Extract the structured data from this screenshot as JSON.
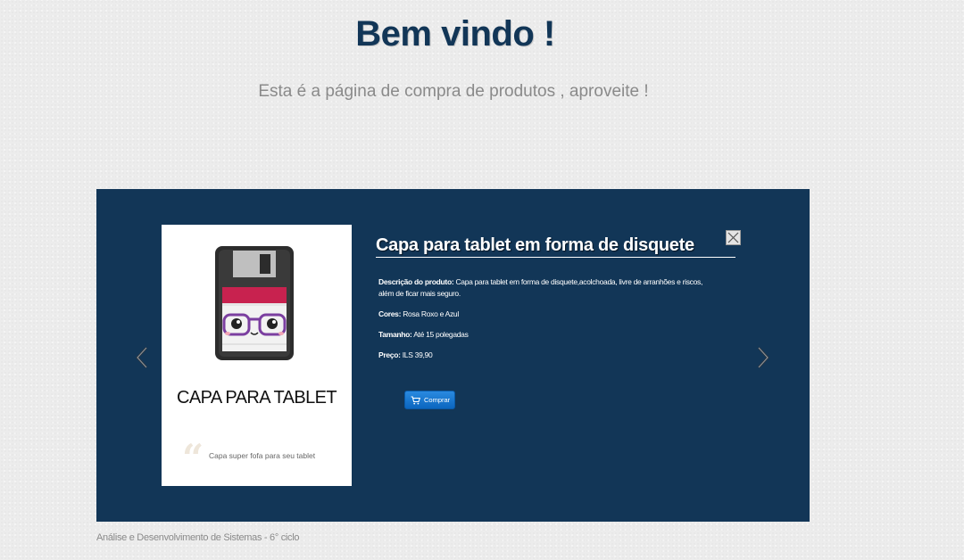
{
  "header": {
    "title": "Bem vindo !",
    "subtitle": "Esta é a página de compra de produtos , aproveite !"
  },
  "banner": {
    "background_color": "#123657",
    "card": {
      "title": "CAPA PARA TABLET",
      "quote": "Capa super fofa para seu tablet",
      "image_icon": "floppy-disk-tablet-case-image"
    },
    "product": {
      "title": "Capa para tablet em forma de disquete",
      "description_label": "Descrição do produto:",
      "description_line1": "Capa para tablet em forma de disquete,acolchoada, livre de arranhões e riscos,",
      "description_line2": "além de ficar mais seguro.",
      "colors_label": "Cores:",
      "colors_value": "Rosa Roxo e Azul",
      "size_label": "Tamanho:",
      "size_value": "Até 15 polegadas",
      "price_label": "Preço:",
      "price_value": "ILS 39,90"
    },
    "buy_button": {
      "label": "Comprar",
      "icon": "cart-icon",
      "color": "#1a76d2"
    },
    "nav": {
      "prev_icon": "chevron-left-icon",
      "next_icon": "chevron-right-icon"
    },
    "close_icon": "close-icon"
  },
  "footer": {
    "text": "Análise e Desenvolvimento de Sistemas - 6° ciclo"
  }
}
